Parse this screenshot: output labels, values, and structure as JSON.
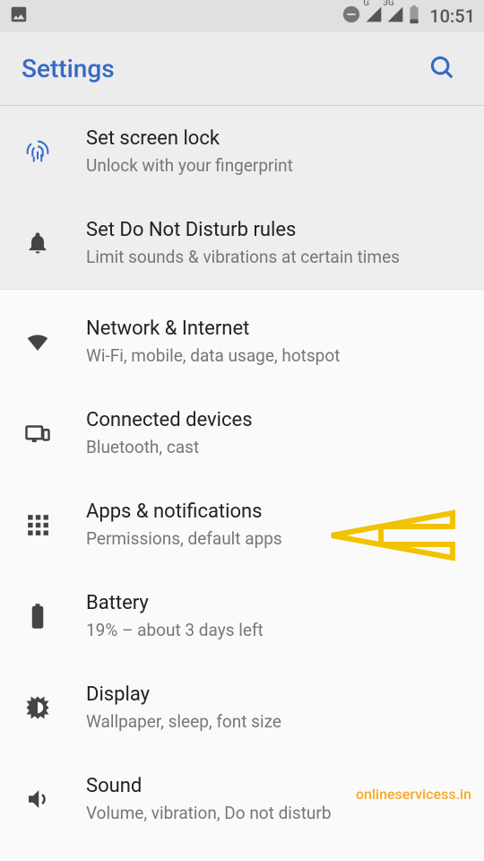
{
  "status_bar": {
    "time": "10:51",
    "net1_label": "G",
    "net2_label": "3G"
  },
  "app_bar": {
    "title": "Settings"
  },
  "suggestions": [
    {
      "title": "Set screen lock",
      "subtitle": "Unlock with your fingerprint"
    },
    {
      "title": "Set Do Not Disturb rules",
      "subtitle": "Limit sounds & vibrations at certain times"
    }
  ],
  "items": [
    {
      "title": "Network & Internet",
      "subtitle": "Wi-Fi, mobile, data usage, hotspot"
    },
    {
      "title": "Connected devices",
      "subtitle": "Bluetooth, cast"
    },
    {
      "title": "Apps & notifications",
      "subtitle": "Permissions, default apps"
    },
    {
      "title": "Battery",
      "subtitle": "19% – about 3 days left"
    },
    {
      "title": "Display",
      "subtitle": "Wallpaper, sleep, font size"
    },
    {
      "title": "Sound",
      "subtitle": "Volume, vibration, Do not disturb"
    }
  ],
  "watermark": "onlineservicess.in",
  "colors": {
    "accent": "#3569c8",
    "arrow": "#f2c200"
  }
}
